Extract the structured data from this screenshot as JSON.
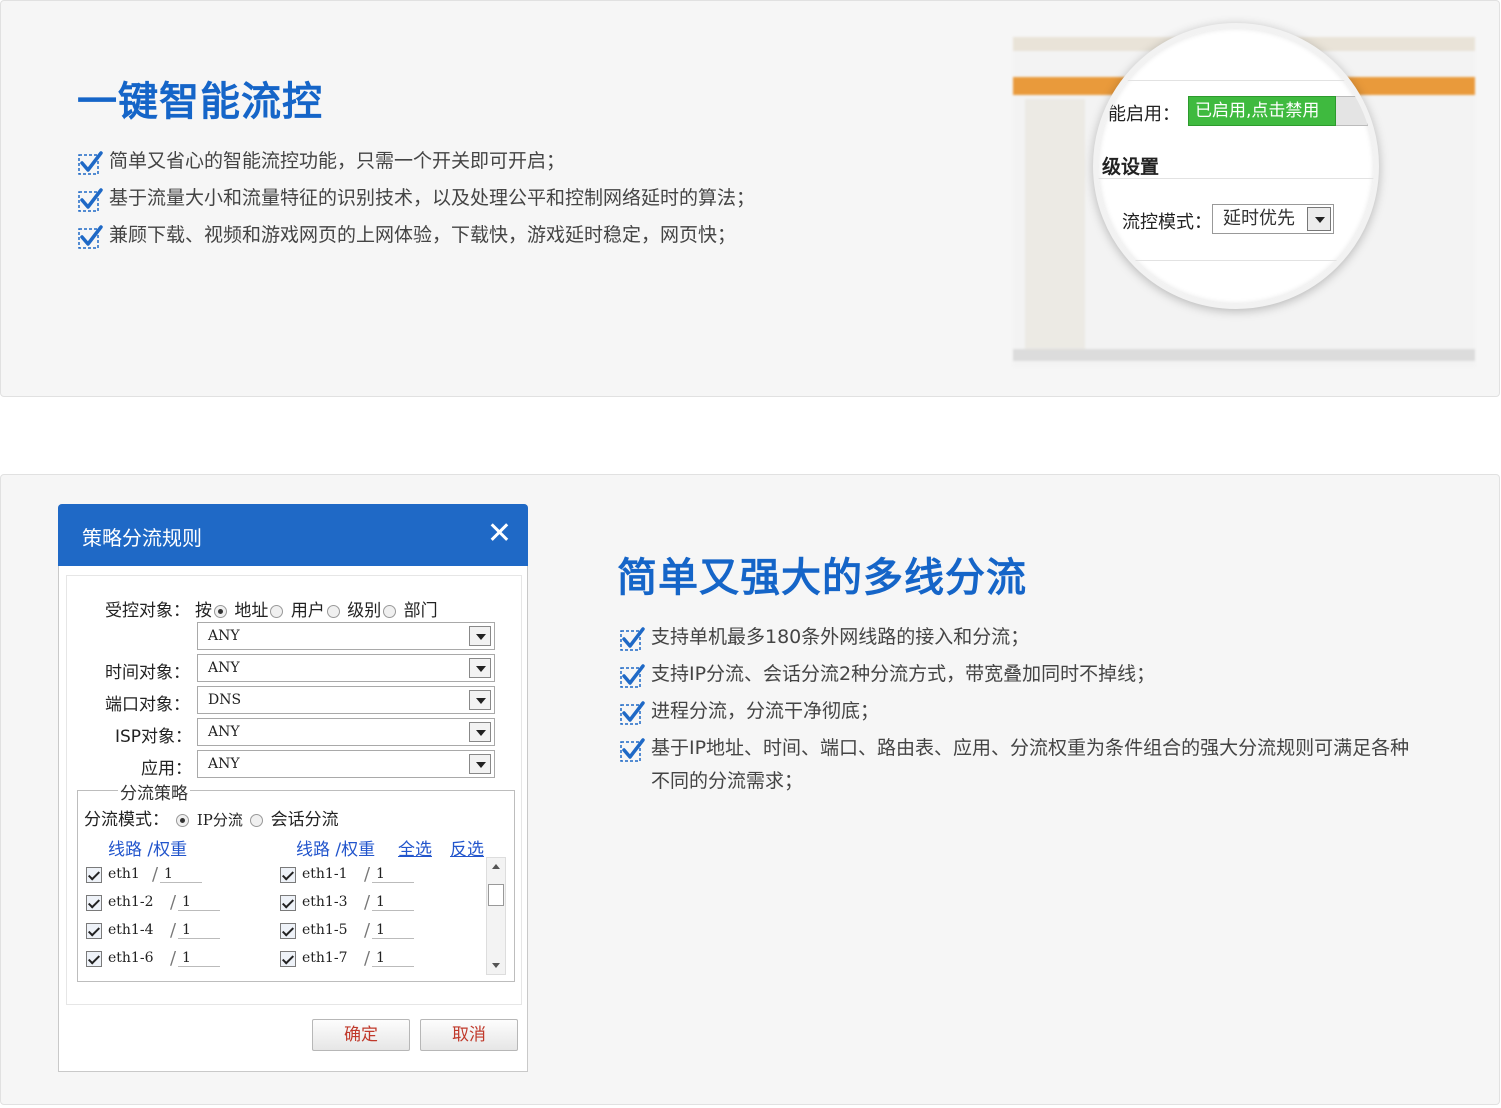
{
  "section1": {
    "title": "一键智能流控",
    "features": [
      "简单又省心的智能流控功能，只需一个开关即可开启；",
      "基于流量大小和流量特征的识别技术，以及处理公平和控制网络延时的算法；",
      "兼顾下载、视频和游戏网页的上网体验，下载快，游戏延时稳定，网页快；"
    ],
    "magnifier": {
      "enable_label": "能启用：",
      "toggle_label": "已启用,点击禁用",
      "advanced_heading": "级设置",
      "mode_label": "流控模式：",
      "mode_value": "延时优先"
    }
  },
  "section2": {
    "title": "简单又强大的多线分流",
    "features": [
      "支持单机最多180条外网线路的接入和分流；",
      "支持IP分流、会话分流2种分流方式，带宽叠加同时不掉线；",
      "进程分流，分流干净彻底；",
      "基于IP地址、时间、端口、路由表、应用、分流权重为条件组合的强大分流规则可满足各种不同的分流需求；"
    ]
  },
  "dialog": {
    "title": "策略分流规则",
    "close_glyph": "✕",
    "controlled_label": "受控对象：",
    "by_label": "按",
    "radio_options": [
      "地址",
      "用户",
      "级别",
      "部门"
    ],
    "controlled_value": "ANY",
    "time_label": "时间对象：",
    "time_value": "ANY",
    "port_label": "端口对象：",
    "port_value": "DNS",
    "isp_label": "ISP对象：",
    "isp_value": "ANY",
    "app_label": "应用：",
    "app_value": "ANY",
    "strategy_legend": "分流策略",
    "mode_label": "分流模式：",
    "mode_options": [
      "IP分流",
      "会话分流"
    ],
    "col_header": "线路 /权重",
    "select_all": "全选",
    "invert": "反选",
    "lines_left": [
      {
        "name": "eth1",
        "weight": "1"
      },
      {
        "name": "eth1-2",
        "weight": "1"
      },
      {
        "name": "eth1-4",
        "weight": "1"
      },
      {
        "name": "eth1-6",
        "weight": "1"
      }
    ],
    "lines_right": [
      {
        "name": "eth1-1",
        "weight": "1"
      },
      {
        "name": "eth1-3",
        "weight": "1"
      },
      {
        "name": "eth1-5",
        "weight": "1"
      },
      {
        "name": "eth1-7",
        "weight": "1"
      }
    ],
    "ok_label": "确定",
    "cancel_label": "取消"
  },
  "colors": {
    "heading_blue": "#1565c8",
    "dialog_header_blue": "#1f69c6",
    "toggle_green": "#3fba3f",
    "button_text_red": "#c0392b",
    "link_blue": "#2255cc"
  }
}
